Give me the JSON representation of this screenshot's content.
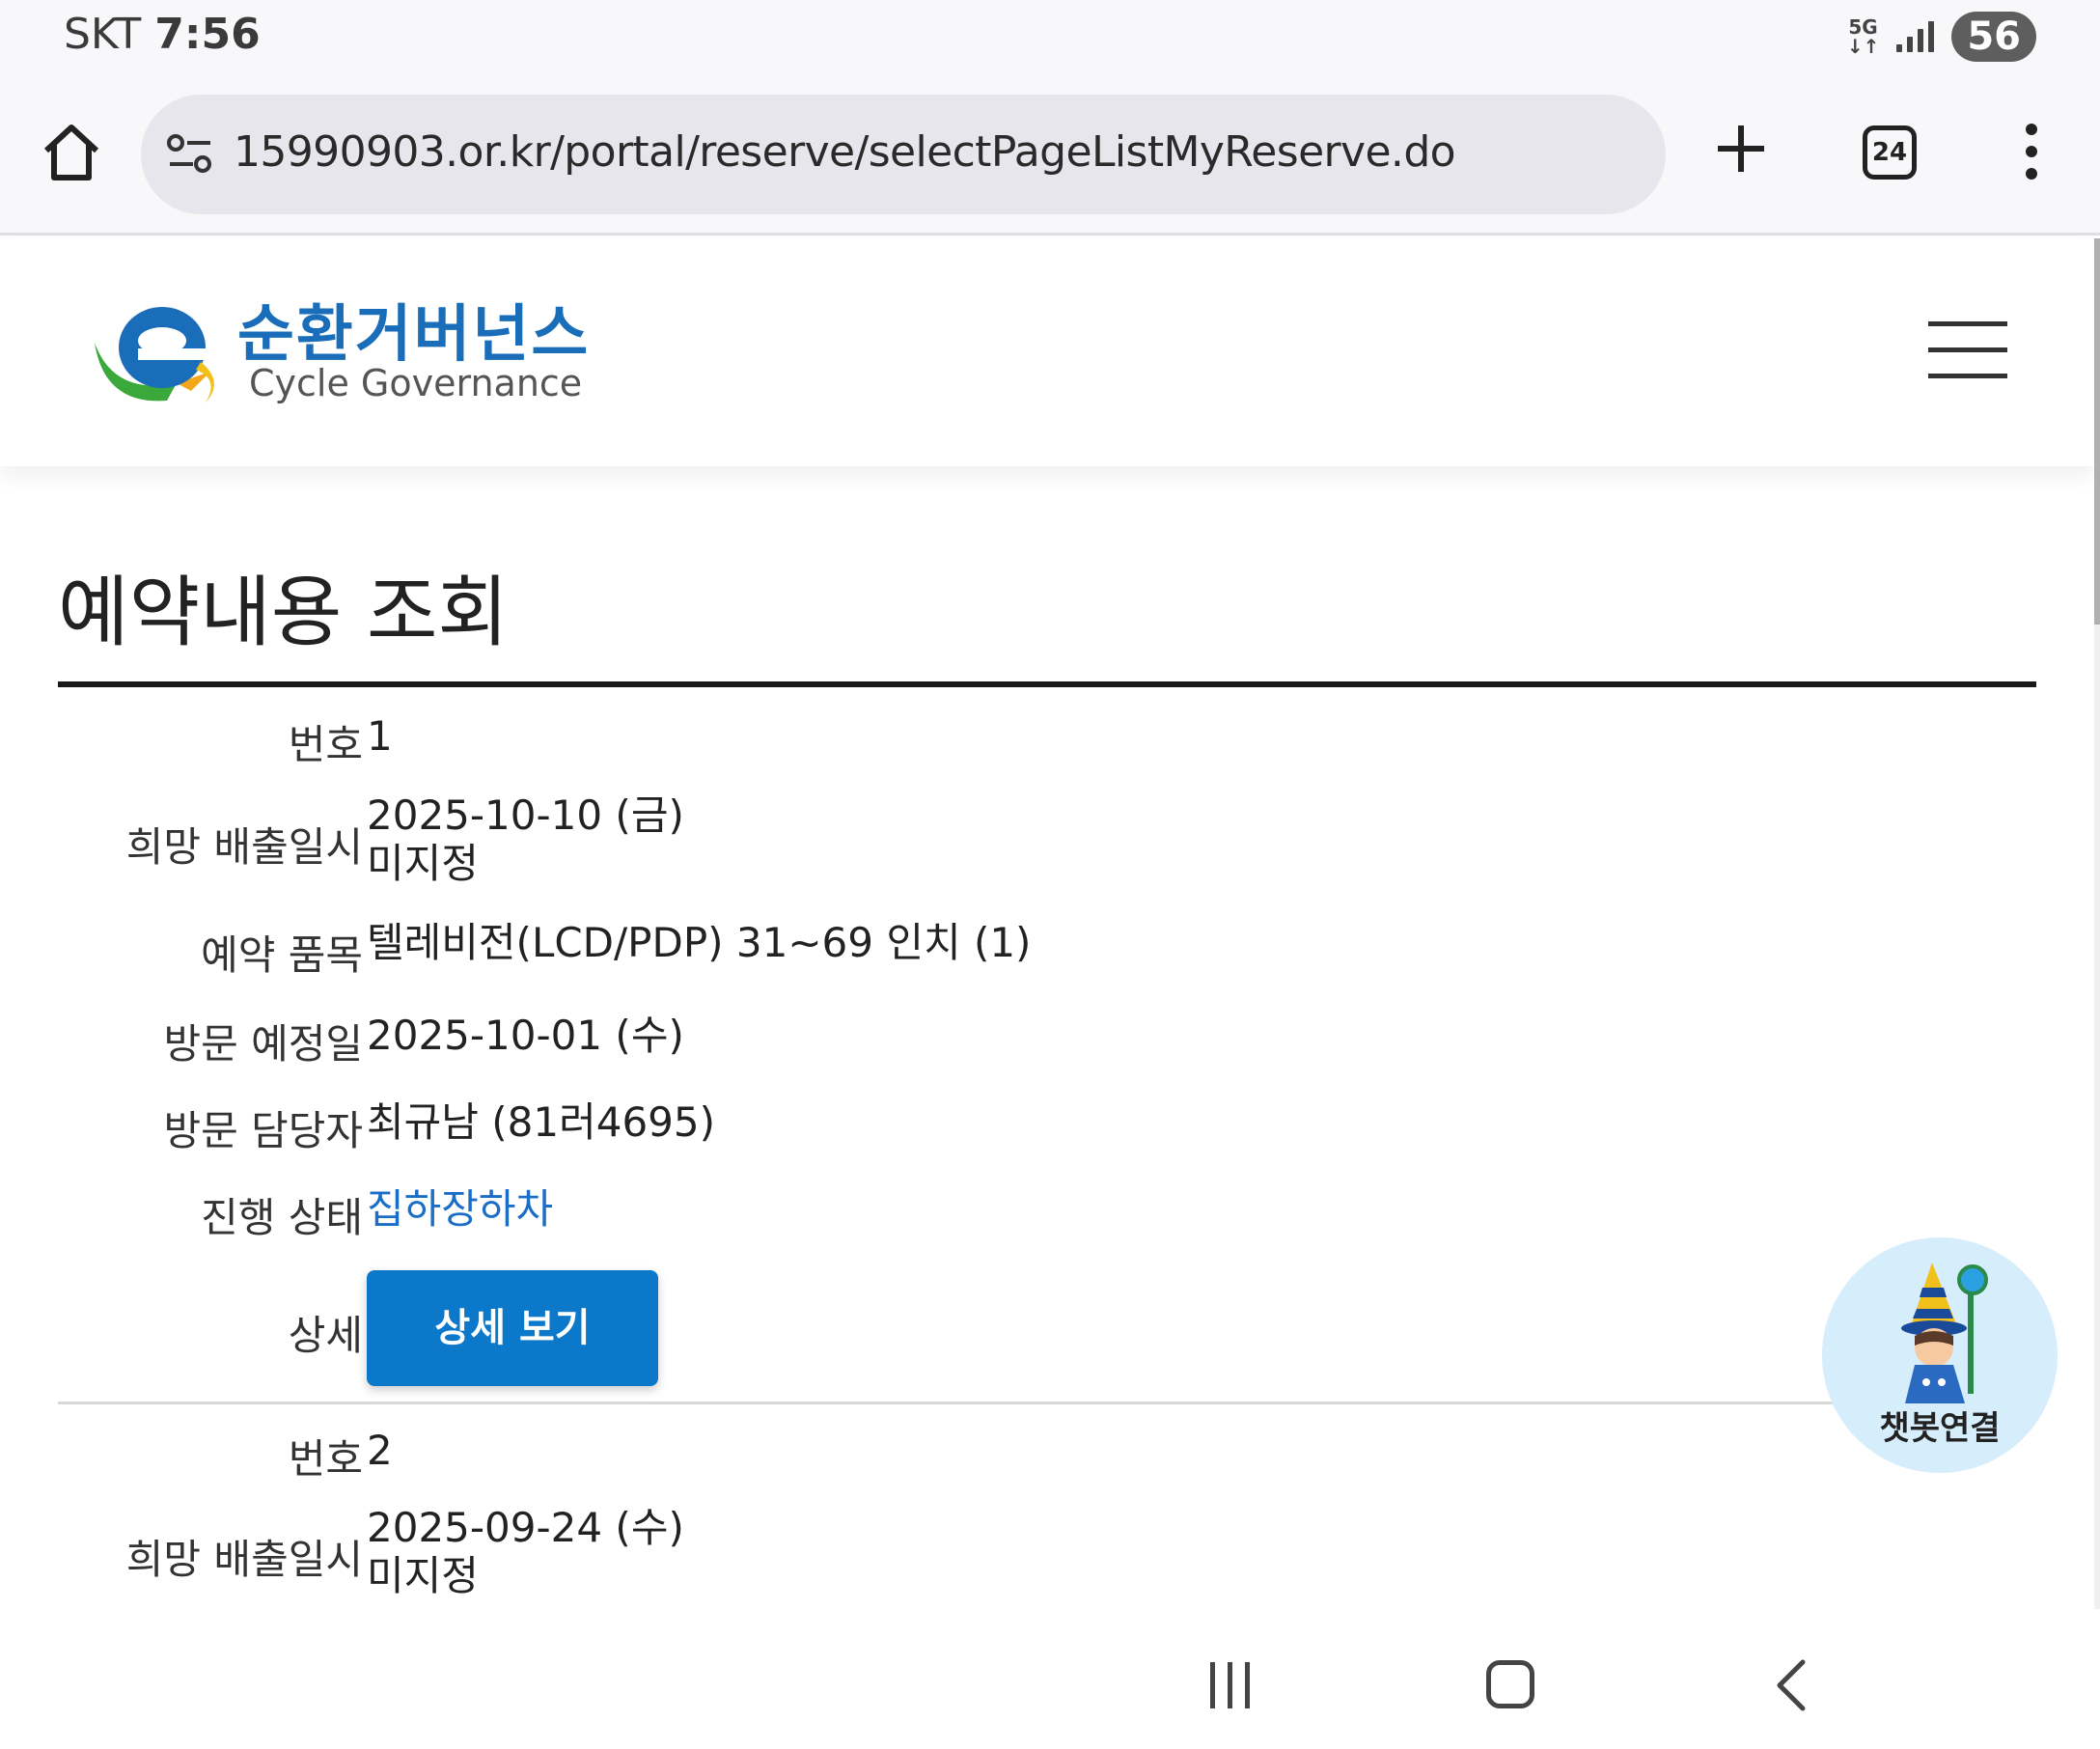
{
  "status_bar": {
    "carrier": "SKT",
    "time": "7:56",
    "network_top": "5G",
    "network_bottom": "↓↑",
    "battery": "56"
  },
  "browser": {
    "url": "15990903.or.kr/portal/reserve/selectPageListMyReserve.do",
    "tab_count": "24"
  },
  "header": {
    "logo_korean": "순환거버넌스",
    "logo_english": "Cycle Governance"
  },
  "page": {
    "title": "예약내용 조회"
  },
  "labels": {
    "number": "번호",
    "desired_date": "희망 배출일시",
    "item": "예약 품목",
    "visit_date": "방문 예정일",
    "visit_staff": "방문 담당자",
    "status": "진행 상태",
    "detail": "상세"
  },
  "records": [
    {
      "number": "1",
      "desired_date": "2025-10-10 (금)",
      "desired_time": "미지정",
      "item": "텔레비전(LCD/PDP) 31~69 인치 (1)",
      "visit_date": "2025-10-01 (수)",
      "visit_staff": "최규남 (81러4695)",
      "status": "집하장하차",
      "detail_button": "상세 보기"
    },
    {
      "number": "2",
      "desired_date": "2025-09-24 (수)",
      "desired_time": "미지정"
    }
  ],
  "chatbot": {
    "label": "챗봇연결"
  },
  "colors": {
    "accent": "#0b78c9",
    "status_text": "#1a6ec7",
    "logo_blue": "#1a6db8",
    "logo_green": "#2a9a3a"
  }
}
